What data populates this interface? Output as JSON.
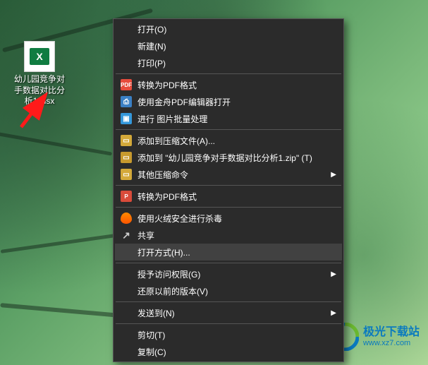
{
  "desktop": {
    "file_label": "幼儿园竞争对手数据对比分析1.xlsx",
    "file_type": "excel"
  },
  "context_menu": {
    "items": [
      {
        "label": "打开(O)",
        "bold": true,
        "icon": ""
      },
      {
        "label": "新建(N)",
        "icon": ""
      },
      {
        "label": "打印(P)",
        "icon": ""
      },
      {
        "sep": true
      },
      {
        "label": "转换为PDF格式",
        "icon": "pdf"
      },
      {
        "label": "使用金舟PDF编辑器打开",
        "icon": "blue"
      },
      {
        "label": "进行 图片批量处理",
        "icon": "img"
      },
      {
        "sep": true
      },
      {
        "label": "添加到压缩文件(A)...",
        "icon": "zip"
      },
      {
        "label": "添加到 \"幼儿园竞争对手数据对比分析1.zip\" (T)",
        "icon": "zip2"
      },
      {
        "label": "其他压缩命令",
        "icon": "zip",
        "submenu": true
      },
      {
        "sep": true
      },
      {
        "label": "转换为PDF格式",
        "icon": "pdf2"
      },
      {
        "sep": true
      },
      {
        "label": "使用火绒安全进行杀毒",
        "icon": "shield"
      },
      {
        "label": "共享",
        "icon": "share"
      },
      {
        "label": "打开方式(H)...",
        "icon": "",
        "highlight": true
      },
      {
        "sep": true
      },
      {
        "label": "授予访问权限(G)",
        "icon": "",
        "submenu": true
      },
      {
        "label": "还原以前的版本(V)",
        "icon": ""
      },
      {
        "sep": true
      },
      {
        "label": "发送到(N)",
        "icon": "",
        "submenu": true
      },
      {
        "sep": true
      },
      {
        "label": "剪切(T)",
        "icon": ""
      },
      {
        "label": "复制(C)",
        "icon": ""
      }
    ]
  },
  "watermark": {
    "title": "极光下载站",
    "url": "www.xz7.com"
  }
}
